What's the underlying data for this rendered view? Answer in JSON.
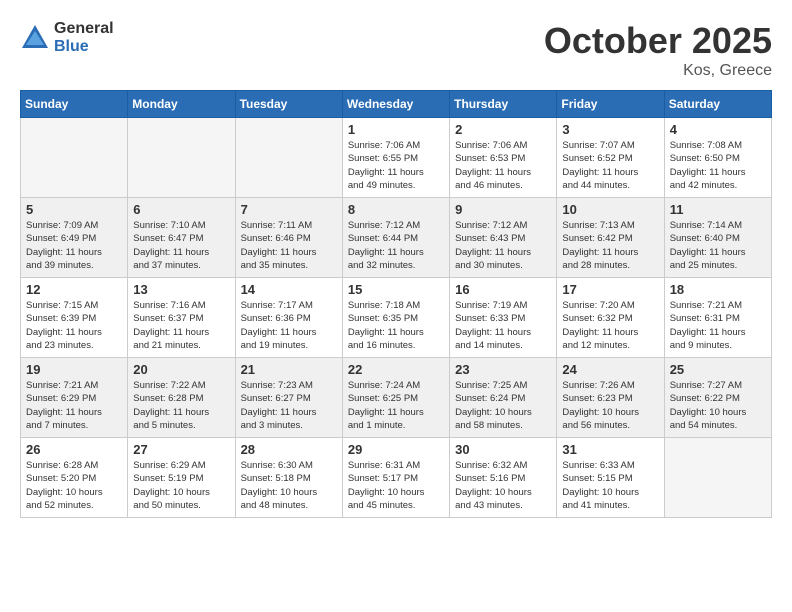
{
  "logo": {
    "general": "General",
    "blue": "Blue"
  },
  "title": "October 2025",
  "location": "Kos, Greece",
  "days_header": [
    "Sunday",
    "Monday",
    "Tuesday",
    "Wednesday",
    "Thursday",
    "Friday",
    "Saturday"
  ],
  "weeks": [
    [
      {
        "day": "",
        "info": "",
        "empty": true
      },
      {
        "day": "",
        "info": "",
        "empty": true
      },
      {
        "day": "",
        "info": "",
        "empty": true
      },
      {
        "day": "1",
        "info": "Sunrise: 7:06 AM\nSunset: 6:55 PM\nDaylight: 11 hours\nand 49 minutes."
      },
      {
        "day": "2",
        "info": "Sunrise: 7:06 AM\nSunset: 6:53 PM\nDaylight: 11 hours\nand 46 minutes."
      },
      {
        "day": "3",
        "info": "Sunrise: 7:07 AM\nSunset: 6:52 PM\nDaylight: 11 hours\nand 44 minutes."
      },
      {
        "day": "4",
        "info": "Sunrise: 7:08 AM\nSunset: 6:50 PM\nDaylight: 11 hours\nand 42 minutes."
      }
    ],
    [
      {
        "day": "5",
        "info": "Sunrise: 7:09 AM\nSunset: 6:49 PM\nDaylight: 11 hours\nand 39 minutes."
      },
      {
        "day": "6",
        "info": "Sunrise: 7:10 AM\nSunset: 6:47 PM\nDaylight: 11 hours\nand 37 minutes."
      },
      {
        "day": "7",
        "info": "Sunrise: 7:11 AM\nSunset: 6:46 PM\nDaylight: 11 hours\nand 35 minutes."
      },
      {
        "day": "8",
        "info": "Sunrise: 7:12 AM\nSunset: 6:44 PM\nDaylight: 11 hours\nand 32 minutes."
      },
      {
        "day": "9",
        "info": "Sunrise: 7:12 AM\nSunset: 6:43 PM\nDaylight: 11 hours\nand 30 minutes."
      },
      {
        "day": "10",
        "info": "Sunrise: 7:13 AM\nSunset: 6:42 PM\nDaylight: 11 hours\nand 28 minutes."
      },
      {
        "day": "11",
        "info": "Sunrise: 7:14 AM\nSunset: 6:40 PM\nDaylight: 11 hours\nand 25 minutes."
      }
    ],
    [
      {
        "day": "12",
        "info": "Sunrise: 7:15 AM\nSunset: 6:39 PM\nDaylight: 11 hours\nand 23 minutes."
      },
      {
        "day": "13",
        "info": "Sunrise: 7:16 AM\nSunset: 6:37 PM\nDaylight: 11 hours\nand 21 minutes."
      },
      {
        "day": "14",
        "info": "Sunrise: 7:17 AM\nSunset: 6:36 PM\nDaylight: 11 hours\nand 19 minutes."
      },
      {
        "day": "15",
        "info": "Sunrise: 7:18 AM\nSunset: 6:35 PM\nDaylight: 11 hours\nand 16 minutes."
      },
      {
        "day": "16",
        "info": "Sunrise: 7:19 AM\nSunset: 6:33 PM\nDaylight: 11 hours\nand 14 minutes."
      },
      {
        "day": "17",
        "info": "Sunrise: 7:20 AM\nSunset: 6:32 PM\nDaylight: 11 hours\nand 12 minutes."
      },
      {
        "day": "18",
        "info": "Sunrise: 7:21 AM\nSunset: 6:31 PM\nDaylight: 11 hours\nand 9 minutes."
      }
    ],
    [
      {
        "day": "19",
        "info": "Sunrise: 7:21 AM\nSunset: 6:29 PM\nDaylight: 11 hours\nand 7 minutes."
      },
      {
        "day": "20",
        "info": "Sunrise: 7:22 AM\nSunset: 6:28 PM\nDaylight: 11 hours\nand 5 minutes."
      },
      {
        "day": "21",
        "info": "Sunrise: 7:23 AM\nSunset: 6:27 PM\nDaylight: 11 hours\nand 3 minutes."
      },
      {
        "day": "22",
        "info": "Sunrise: 7:24 AM\nSunset: 6:25 PM\nDaylight: 11 hours\nand 1 minute."
      },
      {
        "day": "23",
        "info": "Sunrise: 7:25 AM\nSunset: 6:24 PM\nDaylight: 10 hours\nand 58 minutes."
      },
      {
        "day": "24",
        "info": "Sunrise: 7:26 AM\nSunset: 6:23 PM\nDaylight: 10 hours\nand 56 minutes."
      },
      {
        "day": "25",
        "info": "Sunrise: 7:27 AM\nSunset: 6:22 PM\nDaylight: 10 hours\nand 54 minutes."
      }
    ],
    [
      {
        "day": "26",
        "info": "Sunrise: 6:28 AM\nSunset: 5:20 PM\nDaylight: 10 hours\nand 52 minutes."
      },
      {
        "day": "27",
        "info": "Sunrise: 6:29 AM\nSunset: 5:19 PM\nDaylight: 10 hours\nand 50 minutes."
      },
      {
        "day": "28",
        "info": "Sunrise: 6:30 AM\nSunset: 5:18 PM\nDaylight: 10 hours\nand 48 minutes."
      },
      {
        "day": "29",
        "info": "Sunrise: 6:31 AM\nSunset: 5:17 PM\nDaylight: 10 hours\nand 45 minutes."
      },
      {
        "day": "30",
        "info": "Sunrise: 6:32 AM\nSunset: 5:16 PM\nDaylight: 10 hours\nand 43 minutes."
      },
      {
        "day": "31",
        "info": "Sunrise: 6:33 AM\nSunset: 5:15 PM\nDaylight: 10 hours\nand 41 minutes."
      },
      {
        "day": "",
        "info": "",
        "empty": true
      }
    ]
  ]
}
